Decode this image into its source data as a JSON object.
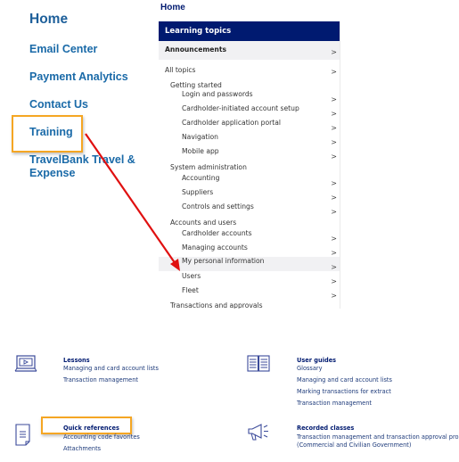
{
  "left_nav": {
    "home": "Home",
    "items": [
      "Email Center",
      "Payment Analytics",
      "Contact Us",
      "Training",
      "TravelBank Travel &",
      "Expense"
    ],
    "highlighted": "Training"
  },
  "panel": {
    "breadcrumb": "Home",
    "header": "Learning topics",
    "rows": [
      {
        "label": "Announcements",
        "chevron": ">"
      },
      {
        "label": "All topics",
        "chevron": ">"
      },
      {
        "label": "Getting started",
        "chevron": ""
      },
      {
        "label": "Login and passwords",
        "chevron": ">"
      },
      {
        "label": "Cardholder-initiated account setup",
        "chevron": ">"
      },
      {
        "label": "Cardholder application portal",
        "chevron": ">"
      },
      {
        "label": "Navigation",
        "chevron": ">"
      },
      {
        "label": "Mobile app",
        "chevron": ">"
      },
      {
        "label": "System administration",
        "chevron": ""
      },
      {
        "label": "Accounting",
        "chevron": ">"
      },
      {
        "label": "Suppliers",
        "chevron": ">"
      },
      {
        "label": "Controls and settings",
        "chevron": ">"
      },
      {
        "label": "Accounts and users",
        "chevron": ""
      },
      {
        "label": "Cardholder accounts",
        "chevron": ">"
      },
      {
        "label": "Managing accounts",
        "chevron": ">"
      },
      {
        "label": "My personal information",
        "chevron": ">"
      },
      {
        "label": "Users",
        "chevron": ">"
      },
      {
        "label": "Fleet",
        "chevron": ">"
      },
      {
        "label": "Transactions and approvals",
        "chevron": ""
      }
    ]
  },
  "resources": {
    "lessons": {
      "title": "Lessons",
      "icon": "monitor-play-icon",
      "links": [
        "Managing and card account lists",
        "Transaction management"
      ]
    },
    "user_guides": {
      "title": "User guides",
      "icon": "open-book-icon",
      "links": [
        "Glossary",
        "Managing and card account lists",
        "Marking transactions for extract",
        "Transaction management"
      ]
    },
    "quick_references": {
      "title": "Quick references",
      "icon": "document-icon",
      "links": [
        "Accounting code favorites",
        "Attachments"
      ]
    },
    "recorded_classes": {
      "title": "Recorded classes",
      "icon": "megaphone-icon",
      "links": [
        "Transaction management and transaction approval process",
        "(Commercial and Civilian Government)"
      ]
    }
  },
  "colors": {
    "nav_link": "#1a6aa8",
    "panel_header": "#001a70",
    "highlight": "#f5a623",
    "arrow": "#e01010"
  }
}
